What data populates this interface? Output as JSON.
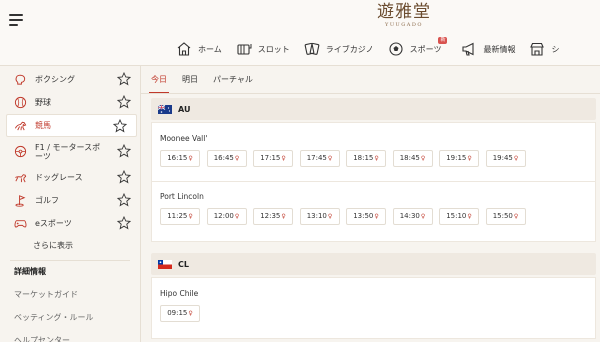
{
  "header": {
    "logo_kanji": "遊雅堂",
    "logo_latin": "YUUGADO",
    "nav": [
      {
        "label": "ホーム",
        "icon": "home-icon"
      },
      {
        "label": "スロット",
        "icon": "slot-icon"
      },
      {
        "label": "ライブカジノ",
        "icon": "cards-icon"
      },
      {
        "label": "スポーツ",
        "icon": "soccer-ball-icon",
        "badge": "新"
      },
      {
        "label": "最新情報",
        "icon": "megaphone-icon"
      },
      {
        "label": "シ",
        "icon": "shop-icon"
      }
    ]
  },
  "sidebar": {
    "items": [
      {
        "label": "ボクシング",
        "icon": "boxing-glove-icon"
      },
      {
        "label": "野球",
        "icon": "baseball-icon"
      },
      {
        "label": "競馬",
        "icon": "horse-racing-icon"
      },
      {
        "label": "F1 / モータースポーツ",
        "icon": "steering-wheel-icon"
      },
      {
        "label": "ドッグレース",
        "icon": "dog-icon"
      },
      {
        "label": "ゴルフ",
        "icon": "golf-icon"
      },
      {
        "label": "eスポーツ",
        "icon": "gamepad-icon"
      }
    ],
    "active_index": 2,
    "more_label": "さらに表示",
    "section_title": "詳細情報",
    "links": [
      "マーケットガイド",
      "ベッティング・ルール",
      "ヘルプセンター"
    ]
  },
  "main": {
    "tabs": [
      "今日",
      "明日",
      "パーチャル"
    ],
    "active_tab": 0,
    "countries": [
      {
        "code": "AU",
        "races": [
          {
            "venue": "Moonee Vall'",
            "times": [
              "16:15",
              "16:45",
              "17:15",
              "17:45",
              "18:15",
              "18:45",
              "19:15",
              "19:45"
            ]
          },
          {
            "venue": "Port Lincoln",
            "times": [
              "11:25",
              "12:00",
              "12:35",
              "13:10",
              "13:50",
              "14:30",
              "15:10",
              "15:50"
            ]
          }
        ]
      },
      {
        "code": "CL",
        "races": [
          {
            "venue": "Hipo Chile",
            "times": [
              "09:15"
            ]
          }
        ]
      }
    ]
  },
  "colors": {
    "accent": "#c0392b",
    "background": "#f7f4ef",
    "panel": "#ffffff",
    "country_bar": "#efe9e1"
  }
}
